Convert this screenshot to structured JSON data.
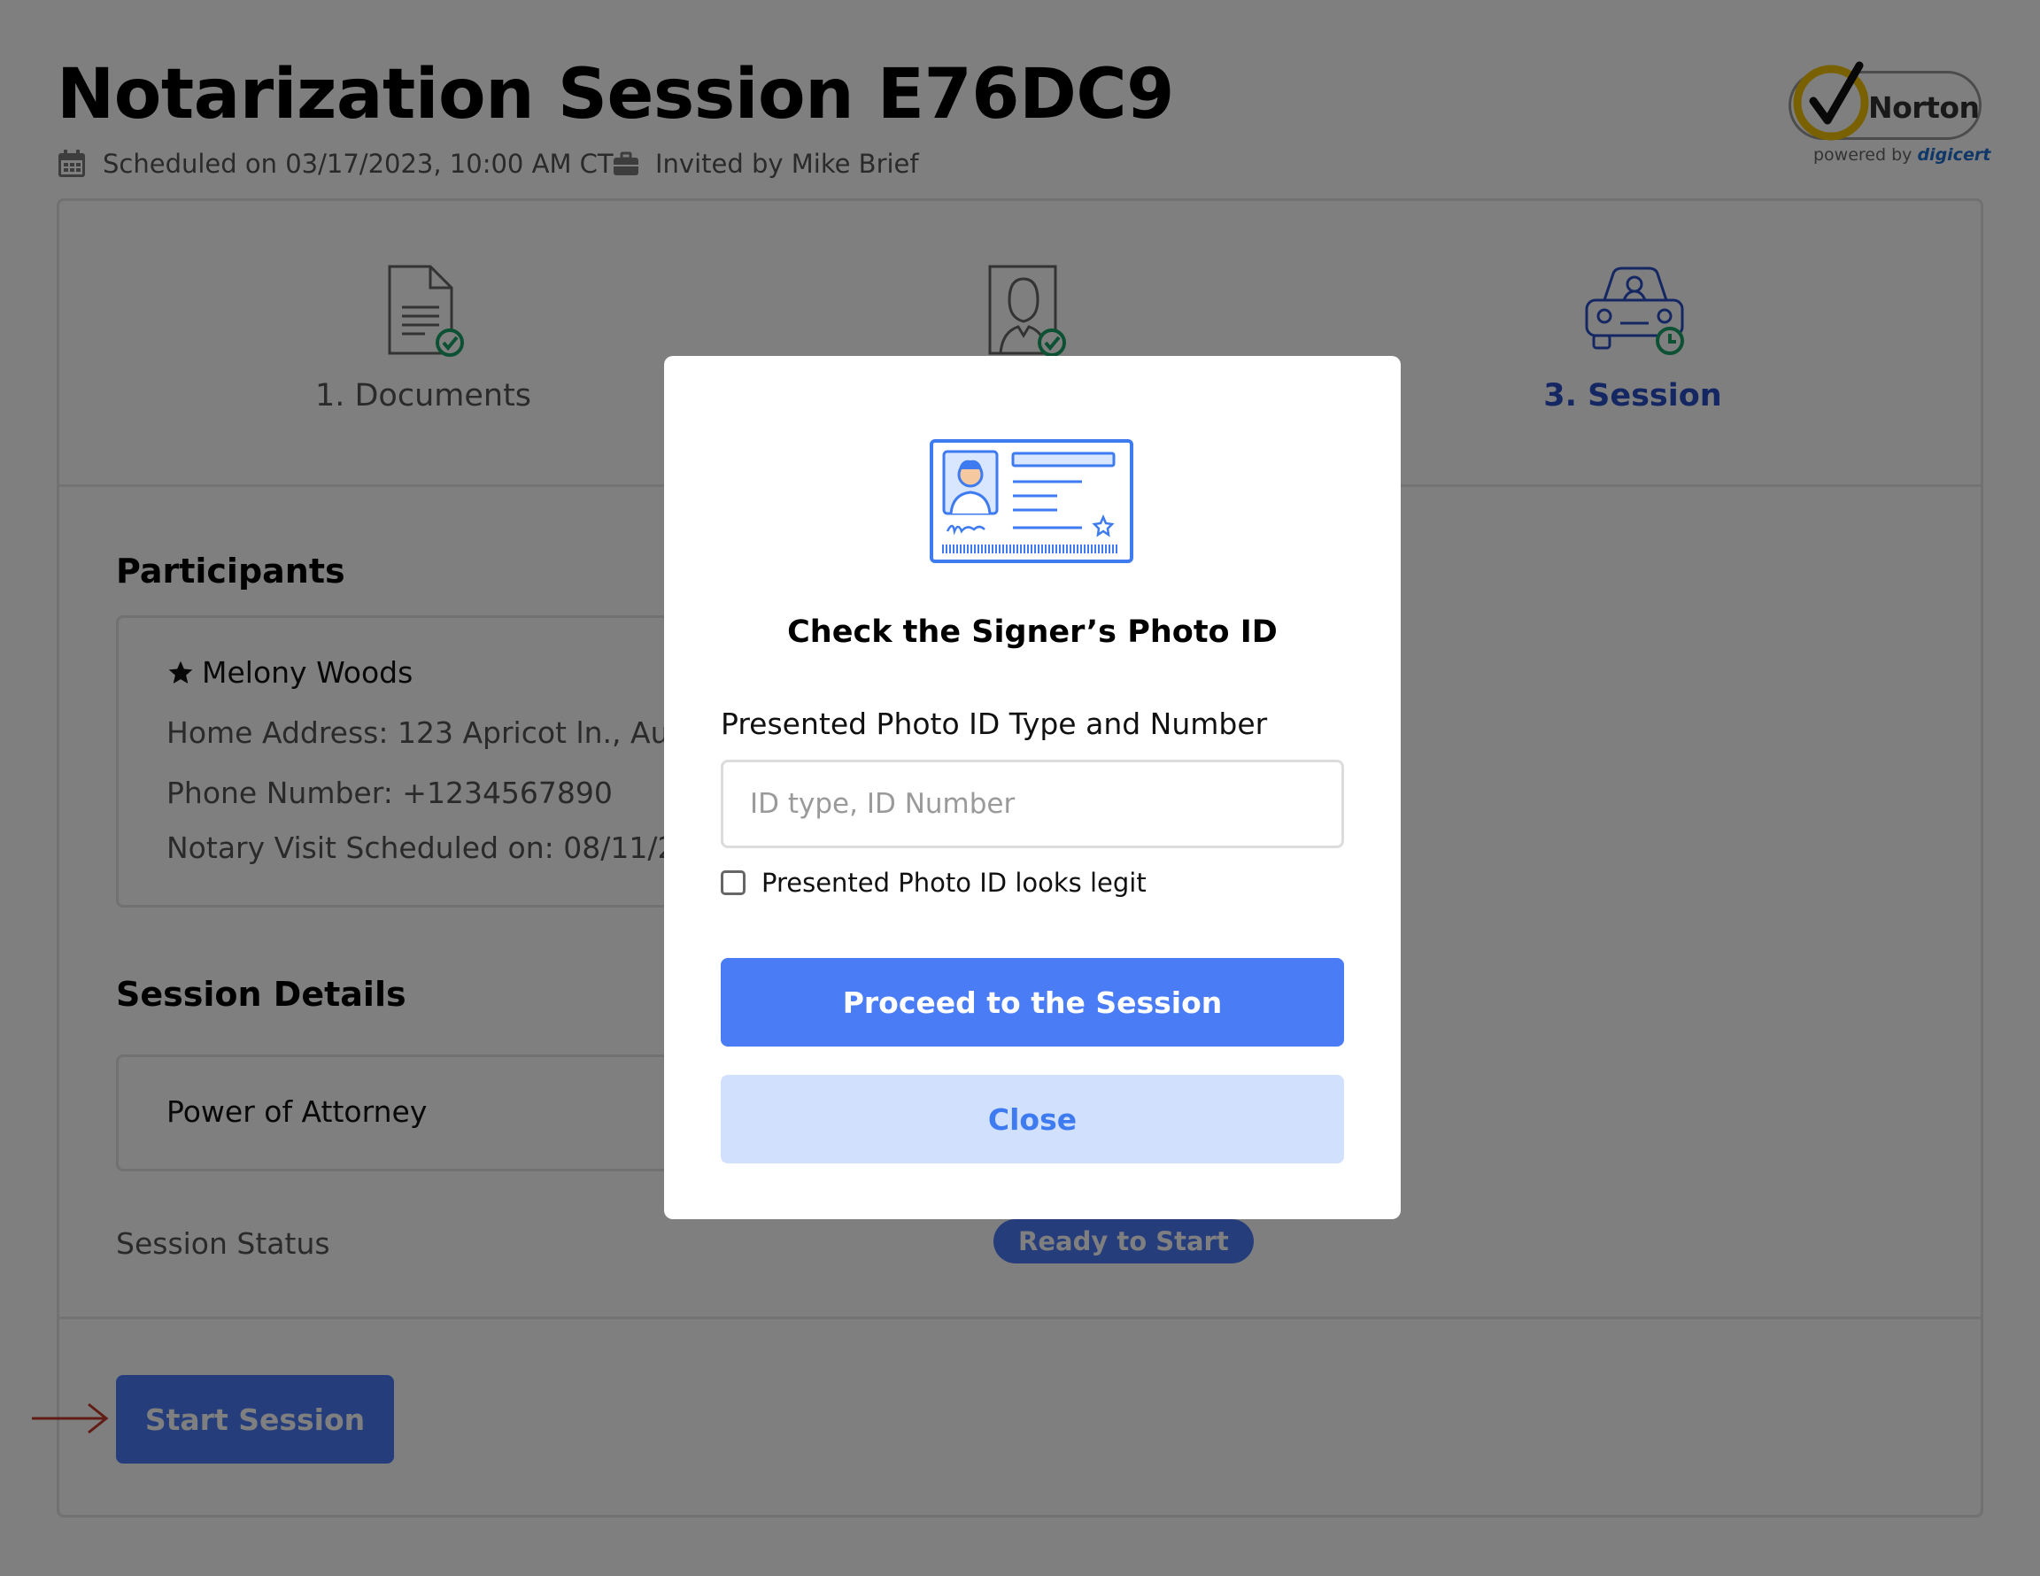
{
  "header": {
    "title": "Notarization Session E76DC9",
    "scheduled": "Scheduled on 03/17/2023, 10:00 AM CT",
    "invited_by": "Invited by Mike Brief"
  },
  "badge": {
    "brand": "Norton",
    "powered_by": "powered by",
    "partner": "digicert"
  },
  "steps": [
    {
      "label": "1. Documents",
      "icon": "document-check-icon",
      "state": "complete"
    },
    {
      "label": "",
      "icon": "portrait-check-icon",
      "state": "complete"
    },
    {
      "label": "3. Session",
      "icon": "car-clock-icon",
      "state": "active"
    }
  ],
  "participants": {
    "title": "Participants",
    "name": "Melony Woods",
    "address": "Home Address: 123 Apricot ln., Austin",
    "phone": "Phone Number: +1234567890",
    "visit": "Notary Visit Scheduled on: 08/11/22,"
  },
  "session_details": {
    "title": "Session Details",
    "document": "Power of Attorney",
    "status_label": "Session Status",
    "status_value": "Ready to Start"
  },
  "actions": {
    "start": "Start Session"
  },
  "modal": {
    "title": "Check the Signer’s Photo ID",
    "field_label": "Presented Photo ID Type and Number",
    "placeholder": "ID type, ID Number",
    "value": "",
    "checkbox_label": "Presented Photo ID looks legit",
    "checkbox_checked": false,
    "proceed": "Proceed to the Session",
    "close": "Close"
  },
  "colors": {
    "accent": "#4a7cf5",
    "accent_light": "#d1e0fc",
    "active_step": "#2b4fc7",
    "check_green": "#1aa36b",
    "arrow_red": "#c0392b"
  }
}
